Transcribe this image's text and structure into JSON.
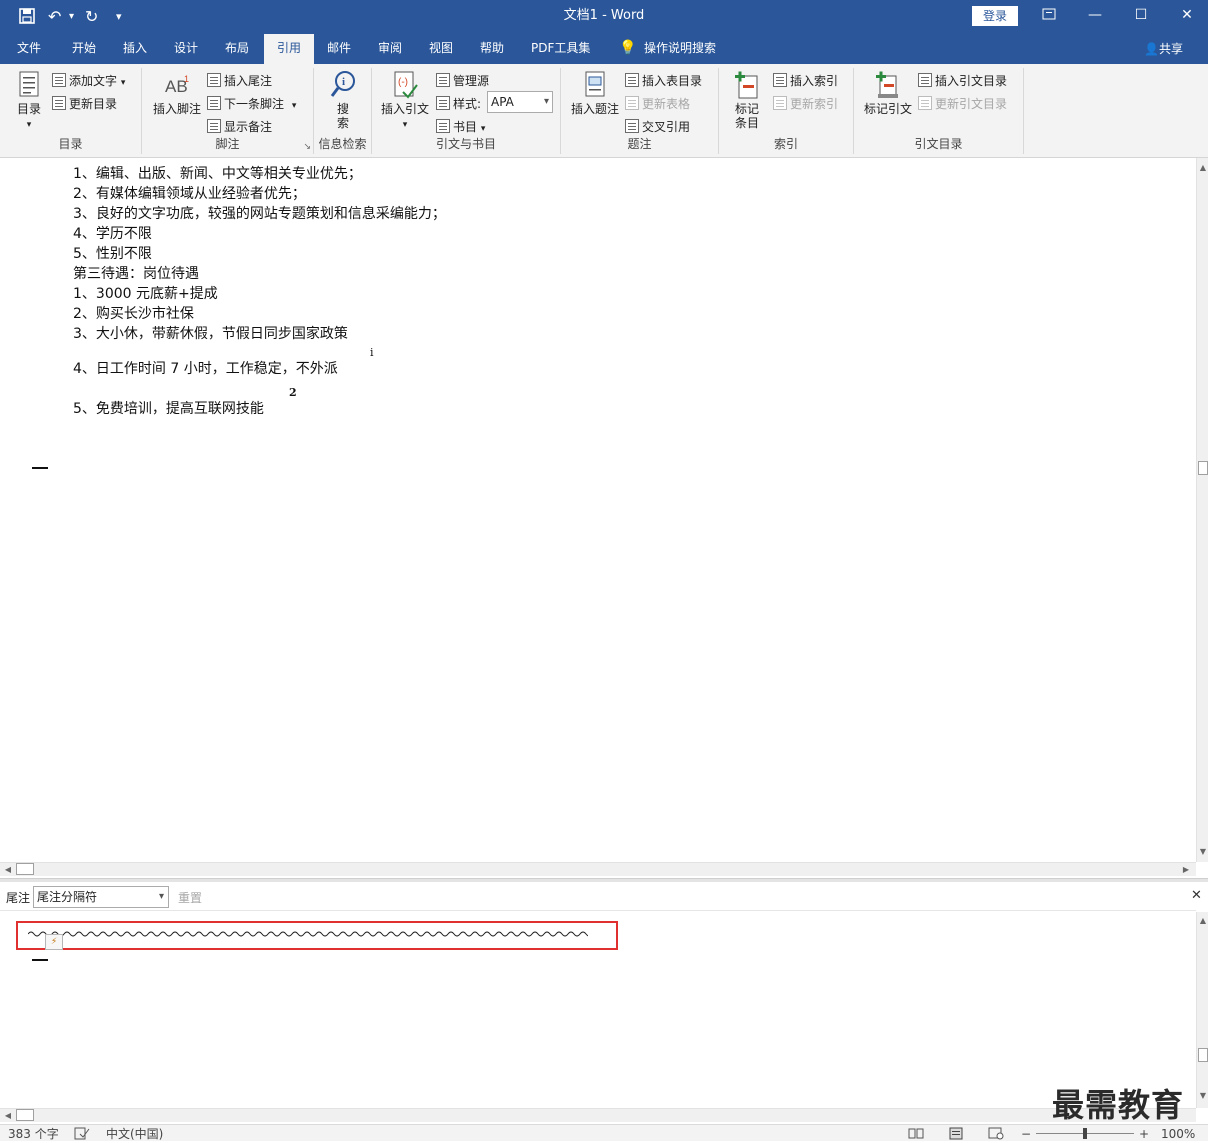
{
  "titlebar": {
    "title": "文档1 - Word",
    "signin": "登录",
    "icons": [
      "save-icon",
      "undo-icon",
      "redo-icon",
      "customize-quick-access-icon"
    ]
  },
  "tabs": [
    {
      "label": "文件"
    },
    {
      "label": "开始"
    },
    {
      "label": "插入"
    },
    {
      "label": "设计"
    },
    {
      "label": "布局"
    },
    {
      "label": "引用",
      "active": true
    },
    {
      "label": "邮件"
    },
    {
      "label": "审阅"
    },
    {
      "label": "视图"
    },
    {
      "label": "帮助"
    },
    {
      "label": "PDF工具集"
    },
    {
      "label": "操作说明搜索"
    }
  ],
  "share": "共享",
  "ribbon": {
    "toc": {
      "label": "目录",
      "big": "目录",
      "add_text": "添加文字",
      "update": "更新目录"
    },
    "footnote": {
      "label": "脚注",
      "big": "插入脚注",
      "insert_endnote": "插入尾注",
      "next_footnote": "下一条脚注",
      "show_notes": "显示备注"
    },
    "research": {
      "label": "信息检索",
      "big": "搜索"
    },
    "citations": {
      "label": "引文与书目",
      "big": "插入引文",
      "manage": "管理源",
      "style_label": "样式:",
      "style_value": "APA",
      "bibliography": "书目"
    },
    "captions": {
      "label": "题注",
      "big": "插入题注",
      "insert_table_figures": "插入表目录",
      "update_table": "更新表格",
      "cross_ref": "交叉引用"
    },
    "index": {
      "label": "索引",
      "big": "标记条目",
      "insert_index": "插入索引",
      "update_index": "更新索引"
    },
    "authorities": {
      "label": "引文目录",
      "big": "标记引文",
      "insert_toa": "插入引文目录",
      "update_toa": "更新引文目录"
    }
  },
  "document": {
    "lines": [
      "1、编辑、出版、新闻、中文等相关专业优先；",
      "2、有媒体编辑领域从业经验者优先；",
      "3、良好的文字功底，较强的网站专题策划和信息采编能力；",
      "4、学历不限",
      "5、性别不限",
      "第三待遇：岗位待遇",
      "1、3000 元底薪+提成",
      "2、购买长沙市社保",
      "3、大小休，带薪休假，节假日同步国家政策",
      "4、日工作时间 7 小时，工作稳定，不外派",
      "5、免费培训，提高互联网技能"
    ],
    "endnote_mark": "i",
    "footnote_mark": "2"
  },
  "notes_pane": {
    "label": "尾注",
    "selected": "尾注分隔符",
    "reset": "重置"
  },
  "status": {
    "word_count": "383 个字",
    "language": "中文(中国)",
    "zoom": "100%"
  },
  "watermark": "最需教育"
}
